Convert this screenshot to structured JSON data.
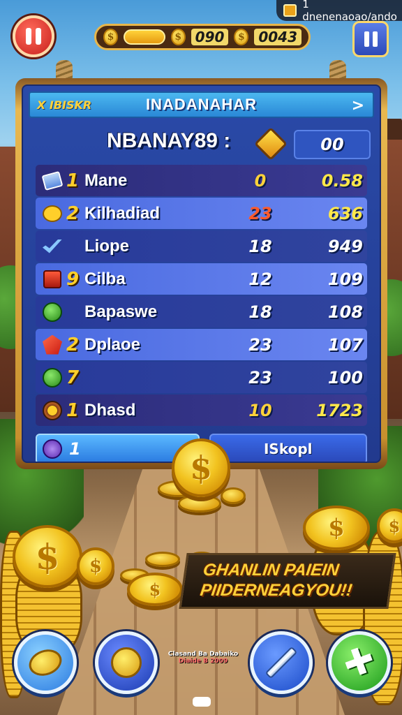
{
  "status_bar": {
    "text": "1 dnenenaoao/ando",
    "icon": "gem-icon"
  },
  "top_bar": {
    "pause_icon": "pause-icon",
    "menu_icon": "pause-icon",
    "coin_value_1": "090",
    "coin_value_2": "0043",
    "coin_symbol": "$"
  },
  "panel": {
    "header_left": "X IBISKR",
    "header_title": "INADANAHAR",
    "header_arrow": ">",
    "subtitle": "NBANAY89 :",
    "value_box": "00",
    "rows": [
      {
        "icon": "document-icon",
        "rank": "1",
        "name": "Mane",
        "col1": "0",
        "col2": "0.58",
        "col1_color": "#ffd23a",
        "col2_color": "#ffe84a",
        "style": "dark"
      },
      {
        "icon": "speech-bubble-icon",
        "rank": "2",
        "name": "Kilhadiad",
        "col1": "23",
        "col2": "636",
        "col1_color": "#ff5a2a",
        "col2_color": "#ffe84a",
        "style": "light"
      },
      {
        "icon": "check-icon",
        "rank": "",
        "name": "Liope",
        "col1": "18",
        "col2": "949",
        "col1_color": "#ffffff",
        "col2_color": "#ffffff",
        "style": "mid"
      },
      {
        "icon": "red-box-icon",
        "rank": "9",
        "name": "Cilba",
        "col1": "12",
        "col2": "109",
        "col1_color": "#ffffff",
        "col2_color": "#ffffff",
        "style": "light"
      },
      {
        "icon": "green-orb-icon",
        "rank": "",
        "name": "Bapaswe",
        "col1": "18",
        "col2": "108",
        "col1_color": "#ffffff",
        "col2_color": "#ffffff",
        "style": "mid"
      },
      {
        "icon": "red-gem-icon",
        "rank": "2",
        "name": "Dplaoe",
        "col1": "23",
        "col2": "107",
        "col1_color": "#ffffff",
        "col2_color": "#ffffff",
        "style": "light"
      },
      {
        "icon": "green-orb-icon",
        "rank": "7",
        "name": "",
        "col1": "23",
        "col2": "100",
        "col1_color": "#ffffff",
        "col2_color": "#ffffff",
        "style": "mid"
      },
      {
        "icon": "heart-icon",
        "rank": "1",
        "name": "Dhasd",
        "col1": "10",
        "col2": "1723",
        "col1_color": "#ffd23a",
        "col2_color": "#ffe84a",
        "style": "dark"
      }
    ],
    "bottom_left_value": "1",
    "bottom_right_label": "ISkopl"
  },
  "banner": {
    "line1": "GHANLIN PAIEIN",
    "line2": "PIIDERNEAGYOU!!"
  },
  "bottom_caption": {
    "line1": "Clasand  Ba  Dabaiko",
    "line2": "Diaide  B 2009"
  },
  "bottom_buttons": [
    {
      "icon": "coin-icon",
      "color": "#4a9ae8"
    },
    {
      "icon": "dollar-coin-icon",
      "color": "#2a4ac8"
    },
    {
      "icon": "pencil-icon",
      "color": "#2a5ad8"
    },
    {
      "icon": "plus-icon",
      "color": "#3ab83a"
    }
  ],
  "colors": {
    "accent_gold": "#ffd23a",
    "panel_blue": "#223a8e",
    "frame_gold": "#e8b850"
  }
}
